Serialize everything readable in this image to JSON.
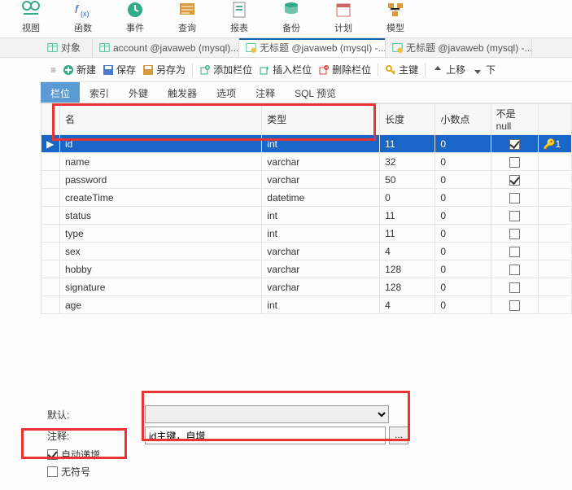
{
  "topToolbar": {
    "view": "视图",
    "function": "函数",
    "event": "事件",
    "query": "查询",
    "report": "报表",
    "backup": "备份",
    "schedule": "计划",
    "model": "模型"
  },
  "tabs": {
    "t0": "对象",
    "t1": "account @javaweb (mysql)...",
    "t2": "无标题 @javaweb (mysql) -...",
    "t3": "无标题 @javaweb (mysql) -..."
  },
  "actions": {
    "new": "新建",
    "save": "保存",
    "saveAs": "另存为",
    "addCol": "添加栏位",
    "insCol": "插入栏位",
    "delCol": "删除栏位",
    "pk": "主键",
    "up": "上移",
    "down": "下"
  },
  "subTabs": {
    "fields": "栏位",
    "index": "索引",
    "fk": "外键",
    "trigger": "触发器",
    "options": "选项",
    "comment": "注释",
    "sql": "SQL 预览"
  },
  "cols": {
    "name": "名",
    "type": "类型",
    "len": "长度",
    "dec": "小数点",
    "nn": "不是 null",
    "pk": ""
  },
  "rows": [
    {
      "name": "id",
      "type": "int",
      "len": "11",
      "dec": "0",
      "nn": true,
      "pk": true,
      "sel": true
    },
    {
      "name": "name",
      "type": "varchar",
      "len": "32",
      "dec": "0",
      "nn": false,
      "pk": false
    },
    {
      "name": "password",
      "type": "varchar",
      "len": "50",
      "dec": "0",
      "nn": true,
      "pk": false
    },
    {
      "name": "createTime",
      "type": "datetime",
      "len": "0",
      "dec": "0",
      "nn": false,
      "pk": false
    },
    {
      "name": "status",
      "type": "int",
      "len": "11",
      "dec": "0",
      "nn": false,
      "pk": false
    },
    {
      "name": "type",
      "type": "int",
      "len": "11",
      "dec": "0",
      "nn": false,
      "pk": false
    },
    {
      "name": "sex",
      "type": "varchar",
      "len": "4",
      "dec": "0",
      "nn": false,
      "pk": false
    },
    {
      "name": "hobby",
      "type": "varchar",
      "len": "128",
      "dec": "0",
      "nn": false,
      "pk": false
    },
    {
      "name": "signature",
      "type": "varchar",
      "len": "128",
      "dec": "0",
      "nn": false,
      "pk": false
    },
    {
      "name": "age",
      "type": "int",
      "len": "4",
      "dec": "0",
      "nn": false,
      "pk": false
    }
  ],
  "pkNum": "1",
  "bottom": {
    "defaultLbl": "默认:",
    "defaultVal": "",
    "commentLbl": "注释:",
    "commentVal": "id主键，自增",
    "autoIncLbl": "自动递增",
    "unsignedLbl": "无符号",
    "autoIncChecked": true,
    "unsignedChecked": false
  }
}
